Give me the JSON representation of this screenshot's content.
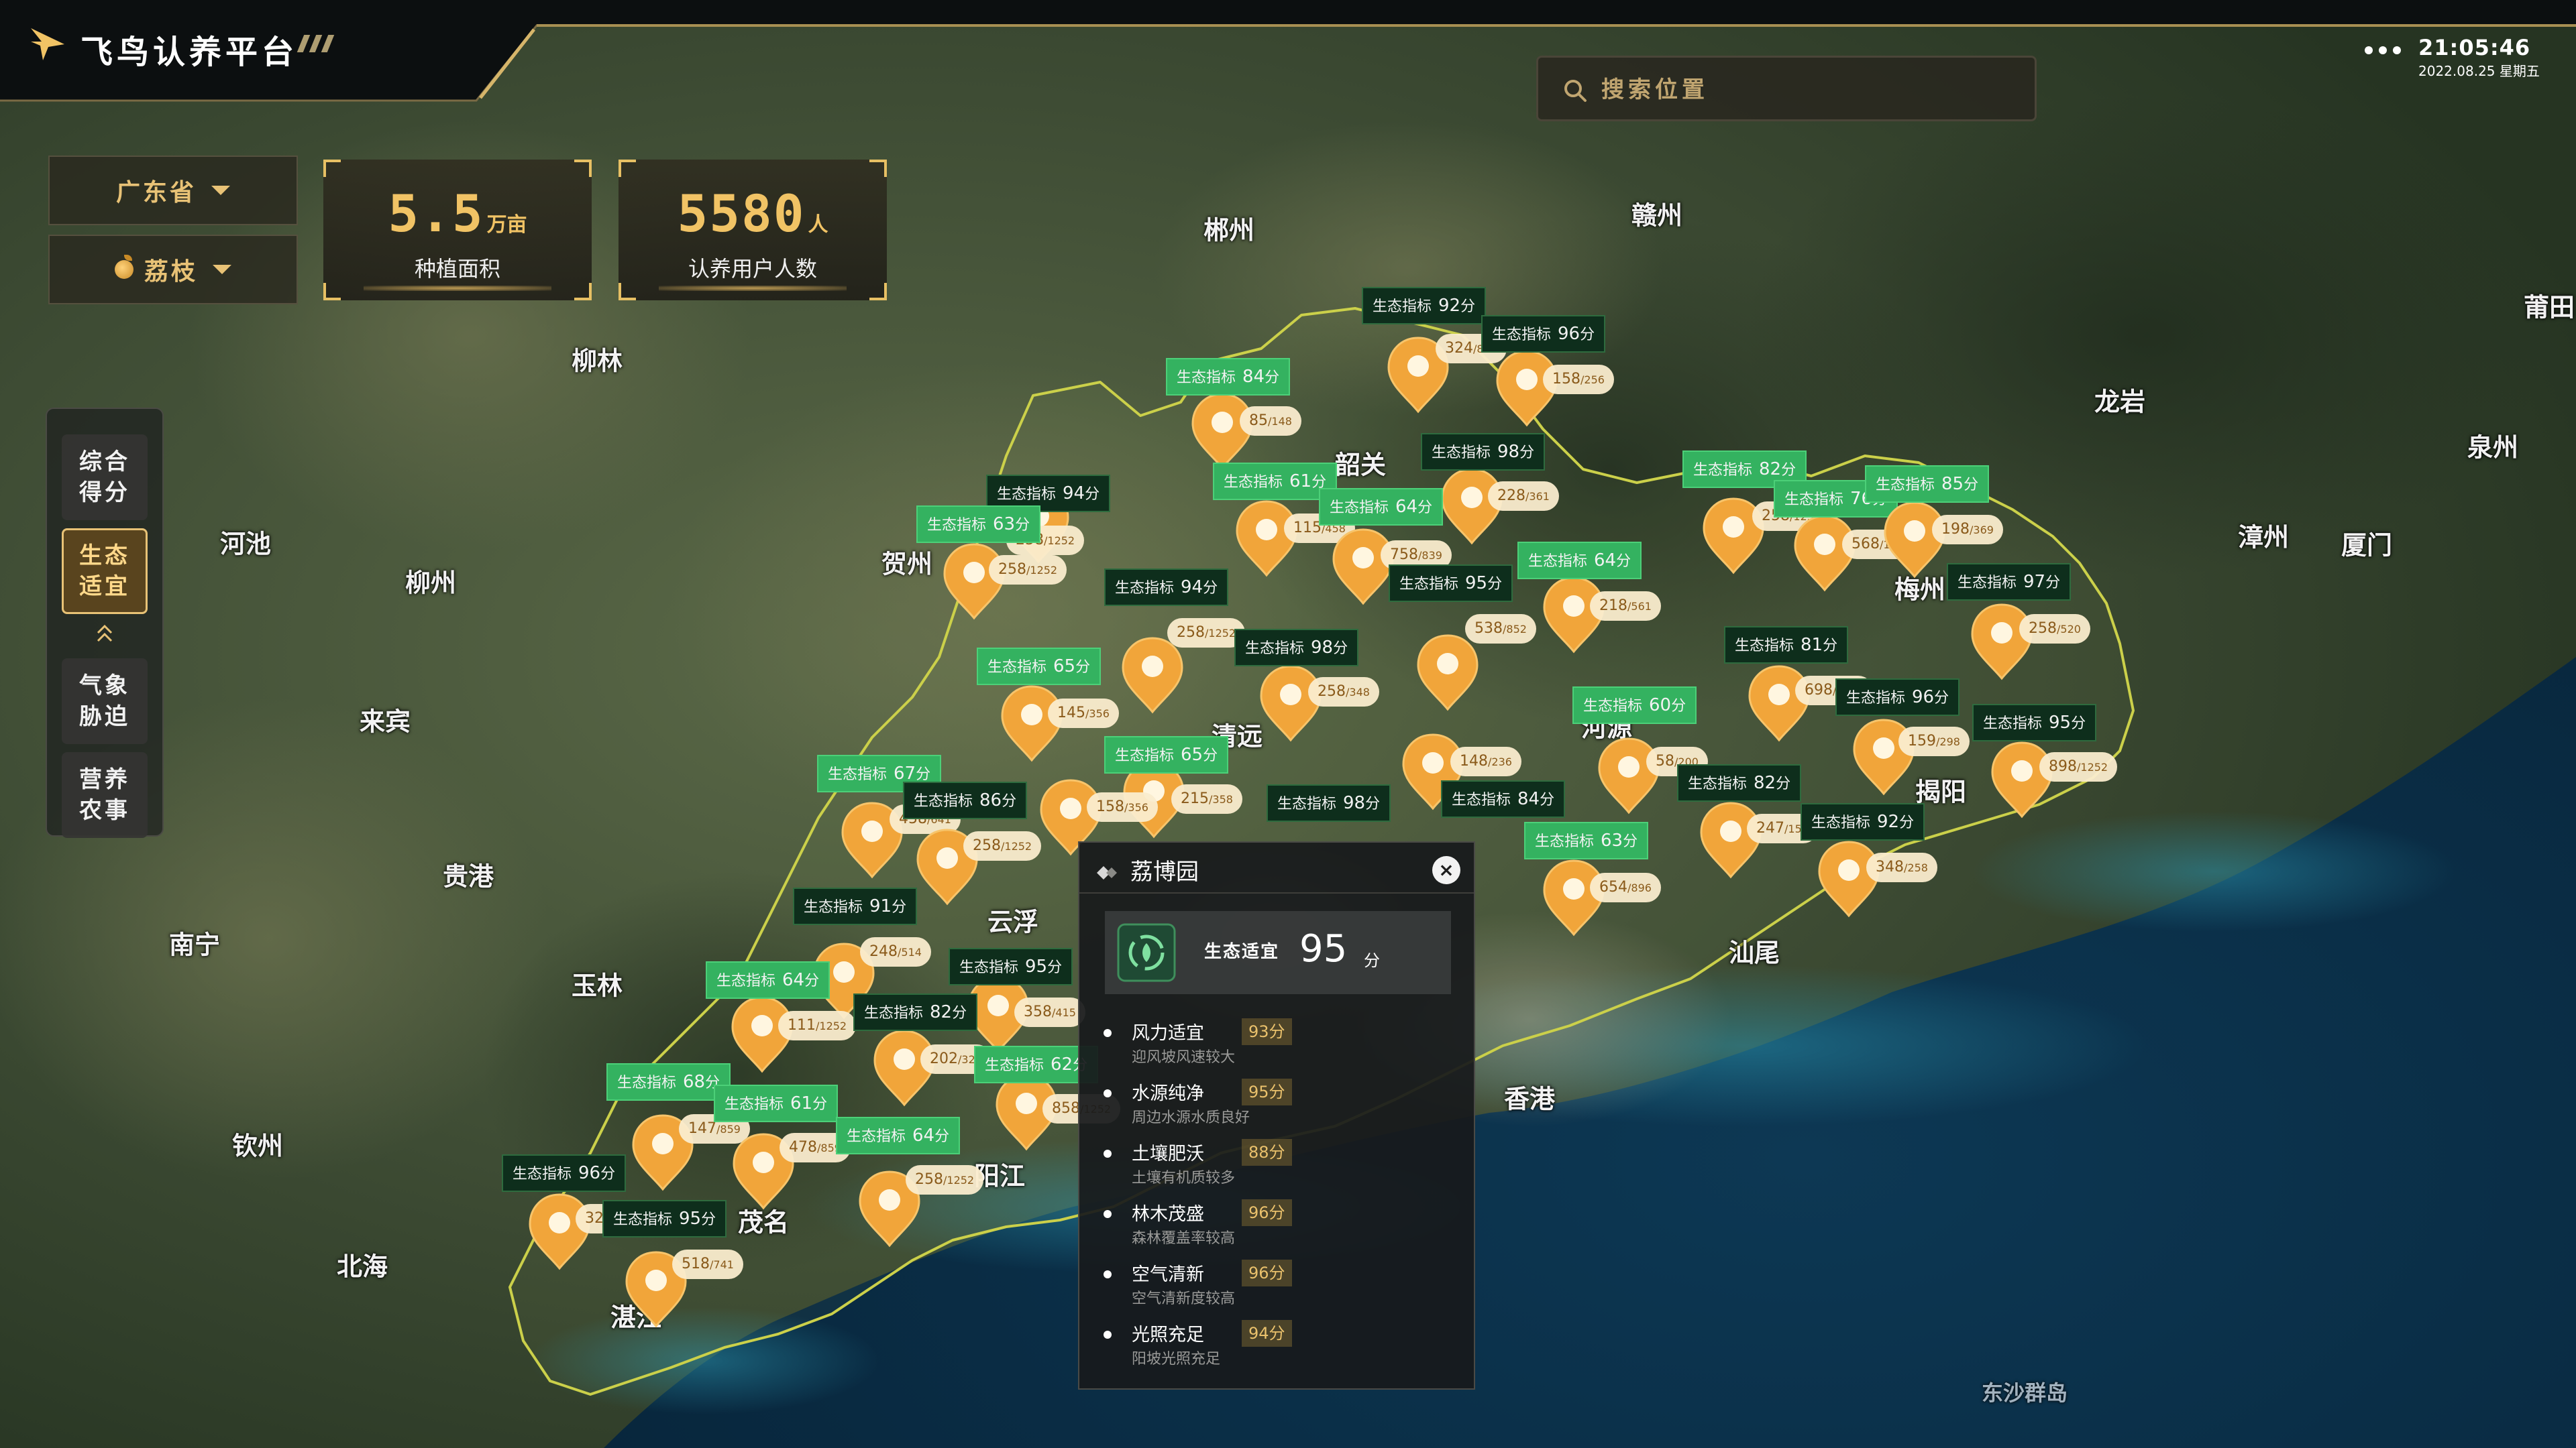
{
  "header": {
    "app_title": "飞鸟认养平台",
    "clock_time": "21:05:46",
    "clock_date": "2022.08.25 星期五"
  },
  "search": {
    "placeholder": "搜索位置"
  },
  "filters": {
    "province": "广东省",
    "crop": "荔枝"
  },
  "stats": [
    {
      "value": "5.5",
      "unit": "万亩",
      "label": "种植面积"
    },
    {
      "value": "5580",
      "unit": "人",
      "label": "认养用户人数"
    }
  ],
  "nav": [
    {
      "label": "综合\n得分",
      "active": false
    },
    {
      "label": "生态\n适宜",
      "active": true
    },
    {
      "label": "气象\n胁迫",
      "active": false
    },
    {
      "label": "营养\n农事",
      "active": false
    }
  ],
  "map": {
    "labels": [
      "郴州",
      "赣州",
      "柳林",
      "龙岩",
      "泉州",
      "莆田",
      "河池",
      "柳州",
      "贺州",
      "韶关",
      "漳州",
      "厦门",
      "梅州",
      "河源",
      "来宾",
      "清远",
      "揭阳",
      "贵港",
      "南宁",
      "云浮",
      "玉林",
      "汕尾",
      "香港",
      "钦州",
      "阳江",
      "茂名",
      "北海",
      "湛江",
      "东沙群岛"
    ]
  },
  "tag_prefix": "生态指标",
  "score_suffix": "分",
  "markers": [
    {
      "cap_main": "324",
      "cap_sub": "/856",
      "tag_score": "92"
    },
    {
      "cap_main": "158",
      "cap_sub": "/256",
      "tag_score": "96"
    },
    {
      "cap_main": "85",
      "cap_sub": "/148",
      "tag_score": "84",
      "green": true
    },
    {
      "cap_main": "228",
      "cap_sub": "/361",
      "tag_score": "98"
    },
    {
      "cap_main": "115",
      "cap_sub": "/458",
      "tag_score": "61",
      "green": true
    },
    {
      "cap_main": "758",
      "cap_sub": "/839",
      "tag_score": "64",
      "green": true
    },
    {
      "cap_main": "258",
      "cap_sub": "/1252",
      "tag_score": "94"
    },
    {
      "cap_main": "258",
      "cap_sub": "/1252",
      "tag_score": "63",
      "green": true
    },
    {
      "cap_main": "218",
      "cap_sub": "/561",
      "tag_score": "64",
      "green": true
    },
    {
      "cap_main": "538",
      "cap_sub": "/852",
      "tag_score": "95"
    },
    {
      "cap_main": "258",
      "cap_sub": "/1252",
      "tag_score": "94"
    },
    {
      "cap_main": "258",
      "cap_sub": "/348",
      "tag_score": "98"
    },
    {
      "cap_main": "145",
      "cap_sub": "/356",
      "tag_score": "65",
      "green": true
    },
    {
      "cap_main": "258",
      "cap_sub": "/1252",
      "tag_score": "82",
      "green": true
    },
    {
      "cap_main": "568",
      "cap_sub": "/1252",
      "tag_score": "76",
      "green": true
    },
    {
      "cap_main": "198",
      "cap_sub": "/369",
      "tag_score": "85",
      "green": true
    },
    {
      "cap_main": "258",
      "cap_sub": "/520",
      "tag_score": "97"
    },
    {
      "cap_main": "698",
      "cap_sub": "/1252",
      "tag_score": "81"
    },
    {
      "cap_main": "159",
      "cap_sub": "/298",
      "tag_score": "96"
    },
    {
      "cap_main": "898",
      "cap_sub": "/1252",
      "tag_score": "95"
    },
    {
      "cap_main": "58",
      "cap_sub": "/200",
      "tag_score": "60",
      "green": true
    },
    {
      "cap_main": "148",
      "cap_sub": "/236",
      "tag_score": "84"
    },
    {
      "cap_main": "247",
      "cap_sub": "/158",
      "tag_score": "82"
    },
    {
      "cap_main": "348",
      "cap_sub": "/258",
      "tag_score": "92"
    },
    {
      "cap_main": "654",
      "cap_sub": "/896",
      "tag_score": "63",
      "green": true
    },
    {
      "cap_main": "215",
      "cap_sub": "/358",
      "tag_score": "65",
      "green": true
    },
    {
      "cap_main": "158",
      "cap_sub": "/356",
      "tag_score": "98"
    },
    {
      "cap_main": "458",
      "cap_sub": "/641",
      "tag_score": "67",
      "green": true
    },
    {
      "cap_main": "258",
      "cap_sub": "/1252",
      "tag_score": "86"
    },
    {
      "cap_main": "248",
      "cap_sub": "/514",
      "tag_score": "91"
    },
    {
      "cap_main": "111",
      "cap_sub": "/1252",
      "tag_score": "64",
      "green": true
    },
    {
      "cap_main": "358",
      "cap_sub": "/415",
      "tag_score": "95"
    },
    {
      "cap_main": "202",
      "cap_sub": "/325",
      "tag_score": "82"
    },
    {
      "cap_main": "858",
      "cap_sub": "/1252",
      "tag_score": "62",
      "green": true
    },
    {
      "cap_main": "147",
      "cap_sub": "/859",
      "tag_score": "68",
      "green": true
    },
    {
      "cap_main": "478",
      "cap_sub": "/859",
      "tag_score": "61",
      "green": true
    },
    {
      "cap_main": "258",
      "cap_sub": "/1252",
      "tag_score": "64",
      "green": true
    },
    {
      "cap_main": "328",
      "cap_sub": "/741",
      "tag_score": "96"
    },
    {
      "cap_main": "518",
      "cap_sub": "/741",
      "tag_score": "95"
    }
  ],
  "popup": {
    "title": "荔博园",
    "close": "×",
    "score_label": "生态适宜",
    "score_value": "95",
    "score_unit": "分",
    "factors": [
      {
        "name": "风力适宜",
        "score": "93分",
        "desc": "迎风坡风速较大"
      },
      {
        "name": "水源纯净",
        "score": "95分",
        "desc": "周边水源水质良好"
      },
      {
        "name": "土壤肥沃",
        "score": "88分",
        "desc": "土壤有机质较多"
      },
      {
        "name": "林木茂盛",
        "score": "96分",
        "desc": "森林覆盖率较高"
      },
      {
        "name": "空气清新",
        "score": "96分",
        "desc": "空气清新度较高"
      },
      {
        "name": "光照充足",
        "score": "94分",
        "desc": "阳坡光照充足"
      }
    ]
  }
}
